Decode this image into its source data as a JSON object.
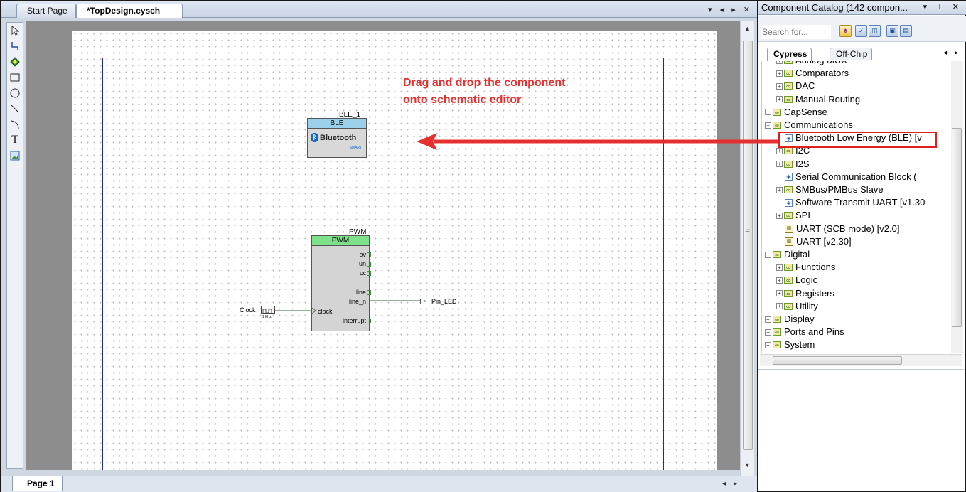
{
  "doc_tabs": {
    "start": "Start Page",
    "active": "*TopDesign.cysch"
  },
  "page_tabs": {
    "page1": "Page 1"
  },
  "schematic": {
    "ble": {
      "instance": "BLE_1",
      "header": "BLE",
      "logo": "Bluetooth",
      "logo_sub": "SMART"
    },
    "pwm": {
      "instance": "PWM",
      "header": "PWM",
      "pins_right": [
        "ov",
        "un",
        "cc",
        "line",
        "line_n",
        "interrupt"
      ],
      "pin_left": "clock"
    },
    "clock": {
      "label": "Clock",
      "freq": "1 kHz"
    },
    "pin_led": {
      "label": "Pin_LED"
    }
  },
  "annotation": {
    "line1": "Drag and drop the component",
    "line2": "onto schematic editor"
  },
  "catalog": {
    "title": "Component Catalog (142 compon...",
    "search_placeholder": "Search for...",
    "tabs": [
      "Cypress",
      "Off-Chip"
    ],
    "tree": [
      {
        "label": "Analog MUX",
        "kind": "folder",
        "exp": "+"
      },
      {
        "label": "Comparators",
        "kind": "folder",
        "exp": "+"
      },
      {
        "label": "DAC",
        "kind": "folder",
        "exp": "+"
      },
      {
        "label": "Manual Routing",
        "kind": "folder",
        "exp": "+"
      },
      {
        "label": "CapSense",
        "kind": "folder",
        "exp": "+"
      },
      {
        "label": "Communications",
        "kind": "folder",
        "exp": "-"
      },
      {
        "label": "Bluetooth Low Energy (BLE) [v",
        "kind": "component"
      },
      {
        "label": "I2C",
        "kind": "folder",
        "exp": "+"
      },
      {
        "label": "I2S",
        "kind": "folder",
        "exp": "+"
      },
      {
        "label": "Serial Communication Block (",
        "kind": "component"
      },
      {
        "label": "SMBus/PMBus Slave",
        "kind": "folder",
        "exp": "+"
      },
      {
        "label": "Software Transmit UART [v1.30",
        "kind": "component"
      },
      {
        "label": "SPI",
        "kind": "folder",
        "exp": "+"
      },
      {
        "label": "UART (SCB mode) [v2.0]",
        "kind": "uart"
      },
      {
        "label": "UART [v2.30]",
        "kind": "uart"
      },
      {
        "label": "Digital",
        "kind": "folder",
        "exp": "-"
      },
      {
        "label": "Functions",
        "kind": "folder",
        "exp": "+"
      },
      {
        "label": "Logic",
        "kind": "folder",
        "exp": "+"
      },
      {
        "label": "Registers",
        "kind": "folder",
        "exp": "+"
      },
      {
        "label": "Utility",
        "kind": "folder",
        "exp": "+"
      },
      {
        "label": "Display",
        "kind": "folder",
        "exp": "+"
      },
      {
        "label": "Ports and Pins",
        "kind": "folder",
        "exp": "+"
      },
      {
        "label": "System",
        "kind": "folder",
        "exp": "+"
      }
    ]
  },
  "colors": {
    "annotation": "#e23232",
    "ble_header": "#9ad0ea",
    "pwm_header": "#7ee08a",
    "frame": "#1d2f8c"
  }
}
